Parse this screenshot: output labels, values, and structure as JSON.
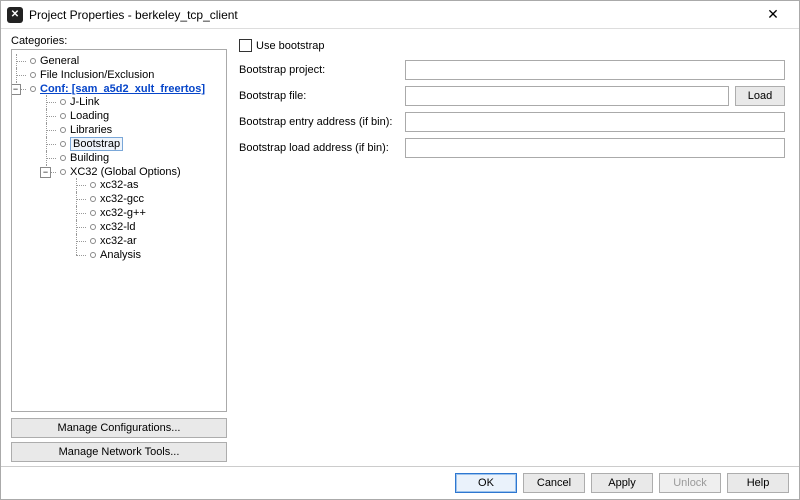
{
  "window": {
    "title": "Project Properties - berkeley_tcp_client"
  },
  "left": {
    "categories_label": "Categories:",
    "tree": {
      "general": "General",
      "file_incl": "File Inclusion/Exclusion",
      "conf": "Conf: [sam_a5d2_xult_freertos]",
      "jlink": "J-Link",
      "loading": "Loading",
      "libraries": "Libraries",
      "bootstrap": "Bootstrap",
      "building": "Building",
      "xc32": "XC32 (Global Options)",
      "xc32_as": "xc32-as",
      "xc32_gcc": "xc32-gcc",
      "xc32_gpp": "xc32-g++",
      "xc32_ld": "xc32-ld",
      "xc32_ar": "xc32-ar",
      "analysis": "Analysis"
    },
    "manage_config": "Manage Configurations...",
    "manage_network": "Manage Network Tools..."
  },
  "form": {
    "use_bootstrap_label": "Use bootstrap",
    "use_bootstrap_checked": false,
    "project_label": "Bootstrap project:",
    "project_value": "",
    "file_label": "Bootstrap file:",
    "file_value": "",
    "load_btn": "Load",
    "entry_label": "Bootstrap entry address (if bin):",
    "entry_value": "",
    "loadaddr_label": "Bootstrap load address (if bin):",
    "loadaddr_value": ""
  },
  "footer": {
    "ok": "OK",
    "cancel": "Cancel",
    "apply": "Apply",
    "unlock": "Unlock",
    "help": "Help"
  }
}
